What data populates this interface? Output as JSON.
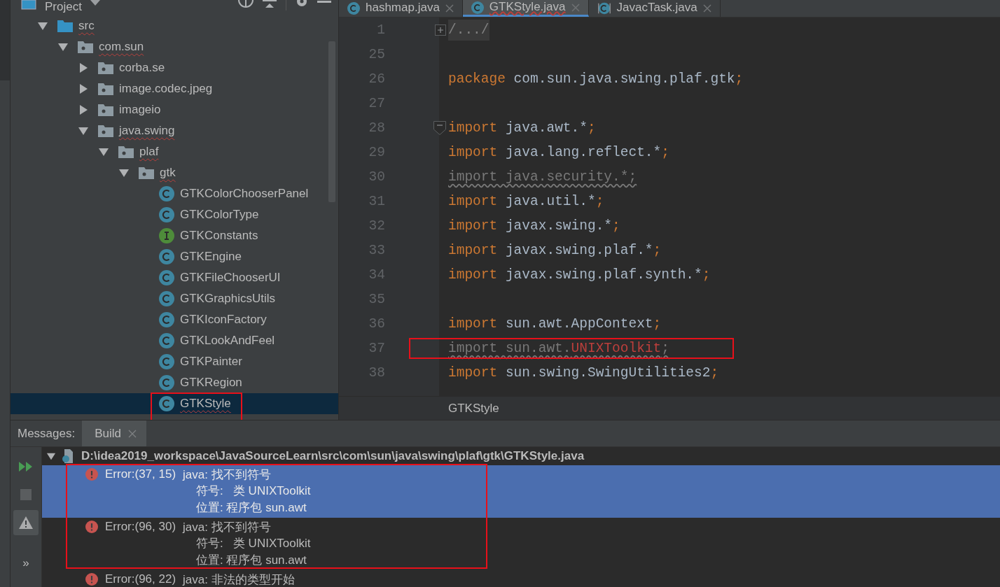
{
  "project_panel": {
    "title": "Project",
    "tree": [
      {
        "label": "src",
        "kind": "source-root",
        "expanded": true,
        "selected": false,
        "spell_warning": true,
        "children": [
          {
            "label": "com.sun",
            "kind": "package",
            "expanded": true,
            "selected": false,
            "spell_warning": true,
            "children": [
              {
                "label": "corba.se",
                "kind": "package",
                "expanded": false,
                "selected": false,
                "spell_warning": false
              },
              {
                "label": "image.codec.jpeg",
                "kind": "package",
                "expanded": false,
                "selected": false,
                "spell_warning": false
              },
              {
                "label": "imageio",
                "kind": "package",
                "expanded": false,
                "selected": false,
                "spell_warning": false
              },
              {
                "label": "java.swing",
                "kind": "package",
                "expanded": true,
                "selected": false,
                "spell_warning": true,
                "children": [
                  {
                    "label": "plaf",
                    "kind": "package",
                    "expanded": true,
                    "selected": false,
                    "spell_warning": true,
                    "children": [
                      {
                        "label": "gtk",
                        "kind": "package",
                        "expanded": true,
                        "selected": false,
                        "spell_warning": true,
                        "children": [
                          {
                            "label": "GTKColorChooserPanel",
                            "kind": "class",
                            "selected": false,
                            "spell_warning": false,
                            "annotated": false
                          },
                          {
                            "label": "GTKColorType",
                            "kind": "class",
                            "selected": false,
                            "spell_warning": false,
                            "annotated": false
                          },
                          {
                            "label": "GTKConstants",
                            "kind": "interface",
                            "selected": false,
                            "spell_warning": false,
                            "annotated": false
                          },
                          {
                            "label": "GTKEngine",
                            "kind": "class",
                            "selected": false,
                            "spell_warning": false,
                            "annotated": false
                          },
                          {
                            "label": "GTKFileChooserUI",
                            "kind": "class",
                            "selected": false,
                            "spell_warning": false,
                            "annotated": false
                          },
                          {
                            "label": "GTKGraphicsUtils",
                            "kind": "class",
                            "selected": false,
                            "spell_warning": false,
                            "annotated": false
                          },
                          {
                            "label": "GTKIconFactory",
                            "kind": "class",
                            "selected": false,
                            "spell_warning": false,
                            "annotated": false
                          },
                          {
                            "label": "GTKLookAndFeel",
                            "kind": "class",
                            "selected": false,
                            "spell_warning": false,
                            "annotated": false
                          },
                          {
                            "label": "GTKPainter",
                            "kind": "class",
                            "selected": false,
                            "spell_warning": false,
                            "annotated": false
                          },
                          {
                            "label": "GTKRegion",
                            "kind": "class",
                            "selected": false,
                            "spell_warning": false,
                            "annotated": false
                          },
                          {
                            "label": "GTKStyle",
                            "kind": "class",
                            "selected": true,
                            "spell_warning": true,
                            "annotated": true
                          }
                        ]
                      }
                    ]
                  }
                ]
              }
            ]
          }
        ]
      }
    ]
  },
  "editor": {
    "tabs": [
      {
        "label": "hashmap.java",
        "kind": "class",
        "selected": false,
        "spell_warning": false
      },
      {
        "label": "GTKStyle.java",
        "kind": "class",
        "selected": true,
        "spell_warning": true
      },
      {
        "label": "JavacTask.java",
        "kind": "compiled",
        "selected": false,
        "spell_warning": false
      }
    ],
    "lines": [
      {
        "number": "1",
        "fold_collapsed": true,
        "annotated": false,
        "tokens": [
          {
            "text": "/.../",
            "kind": "folded"
          }
        ]
      },
      {
        "number": "25",
        "annotated": false
      },
      {
        "number": "26",
        "annotated": false,
        "tokens": [
          {
            "text": "package",
            "kind": "keyword"
          },
          {
            "text": " com.sun.java.swing.plaf.gtk",
            "kind": "plain"
          },
          {
            "text": ";",
            "kind": "punct"
          }
        ]
      },
      {
        "number": "27",
        "annotated": false
      },
      {
        "number": "28",
        "fold_collapsed": false,
        "annotated": false,
        "tokens": [
          {
            "text": "import",
            "kind": "keyword"
          },
          {
            "text": " java.awt.*",
            "kind": "plain"
          },
          {
            "text": ";",
            "kind": "punct"
          }
        ]
      },
      {
        "number": "29",
        "annotated": false,
        "tokens": [
          {
            "text": "import",
            "kind": "keyword"
          },
          {
            "text": " java.lang.reflect.*",
            "kind": "plain"
          },
          {
            "text": ";",
            "kind": "punct"
          }
        ]
      },
      {
        "number": "30",
        "annotated": false,
        "tokens": [
          {
            "text": "import java.security.*;",
            "kind": "unused"
          }
        ]
      },
      {
        "number": "31",
        "annotated": false,
        "tokens": [
          {
            "text": "import",
            "kind": "keyword"
          },
          {
            "text": " java.util.*",
            "kind": "plain"
          },
          {
            "text": ";",
            "kind": "punct"
          }
        ]
      },
      {
        "number": "32",
        "annotated": false,
        "tokens": [
          {
            "text": "import",
            "kind": "keyword"
          },
          {
            "text": " javax.swing.*",
            "kind": "plain"
          },
          {
            "text": ";",
            "kind": "punct"
          }
        ]
      },
      {
        "number": "33",
        "annotated": false,
        "tokens": [
          {
            "text": "import",
            "kind": "keyword"
          },
          {
            "text": " javax.swing.plaf.*",
            "kind": "plain"
          },
          {
            "text": ";",
            "kind": "punct"
          }
        ]
      },
      {
        "number": "34",
        "annotated": false,
        "tokens": [
          {
            "text": "import",
            "kind": "keyword"
          },
          {
            "text": " javax.swing.plaf.synth.*",
            "kind": "plain"
          },
          {
            "text": ";",
            "kind": "punct"
          }
        ]
      },
      {
        "number": "35",
        "annotated": false
      },
      {
        "number": "36",
        "annotated": false,
        "tokens": [
          {
            "text": "import",
            "kind": "keyword"
          },
          {
            "text": " sun.awt.AppContext",
            "kind": "plain"
          },
          {
            "text": ";",
            "kind": "punct"
          }
        ]
      },
      {
        "number": "37",
        "annotated": true,
        "tokens": [
          {
            "text": "import sun.awt.",
            "kind": "unused"
          },
          {
            "text": "UNIXToolkit",
            "kind": "error"
          },
          {
            "text": ";",
            "kind": "unused"
          }
        ]
      },
      {
        "number": "38",
        "annotated": false,
        "tokens": [
          {
            "text": "import",
            "kind": "keyword"
          },
          {
            "text": " sun.swing.SwingUtilities2",
            "kind": "plain"
          },
          {
            "text": ";",
            "kind": "punct"
          }
        ]
      }
    ],
    "breadcrumb": "GTKStyle"
  },
  "messages_panel": {
    "label": "Messages:",
    "annotated": true,
    "tabs": [
      {
        "label": "Build",
        "selected": true
      }
    ],
    "toolbar": [
      {
        "kind": "rerun",
        "on": false
      },
      {
        "kind": "stop",
        "on": false
      },
      {
        "kind": "warnings",
        "on": true
      },
      {
        "kind": "more",
        "on": false,
        "label": "»"
      }
    ],
    "file": {
      "path": "D:\\idea2019_workspace\\JavaSourceLearn\\src\\com\\sun\\java\\swing\\plaf\\gtk\\GTKStyle.java",
      "expanded": true
    },
    "errors": [
      {
        "location": "Error:(37, 15)",
        "message": "java: 找不到符号",
        "details": [
          "符号:   类 UNIXToolkit",
          "位置: 程序包 sun.awt"
        ],
        "selected": true
      },
      {
        "location": "Error:(96, 30)",
        "message": "java: 找不到符号",
        "details": [
          "符号:   类 UNIXToolkit",
          "位置: 程序包 sun.awt"
        ],
        "selected": false
      },
      {
        "location": "Error:(96, 22)",
        "message": "java: 非法的类型开始",
        "selected": false
      }
    ]
  }
}
